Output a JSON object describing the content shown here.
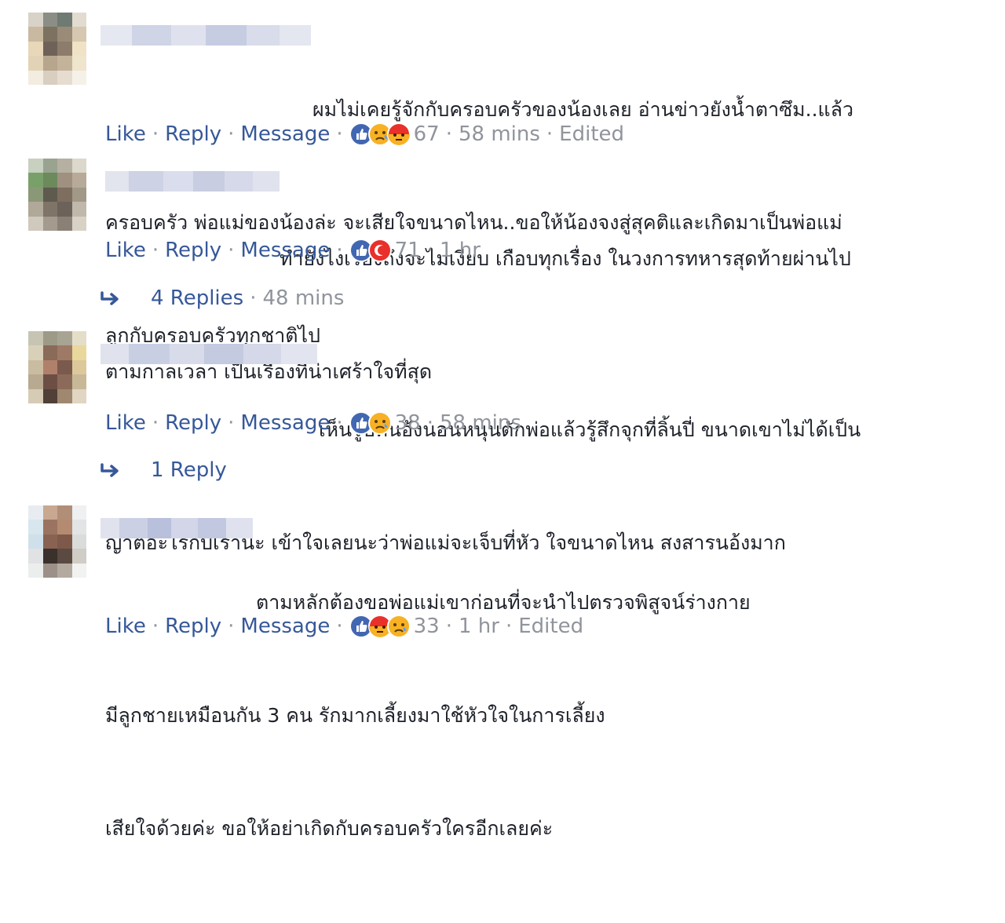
{
  "actions": {
    "like": "Like",
    "reply": "Reply",
    "message": "Message",
    "separator": "·"
  },
  "comments": [
    {
      "lines": [
        "ผมไม่เคยรู้จักกับครอบครัวของน้องเลย อ่านข่าวยังน้ำตาซึม..แล้ว",
        "ครอบครัว พ่อแม่ของน้องล่ะ จะเสียใจขนาดไหน..ขอให้น้องจงสู่สุคติและเกิดมาเป็นพ่อแม่",
        "ลูกกับครอบครัวทุกชาติไป"
      ],
      "reaction_icons": [
        "like-icon",
        "sad-icon",
        "angry-icon"
      ],
      "reaction_count": "67",
      "time": "58 mins",
      "edited": "Edited"
    },
    {
      "lines": [
        "ทำยังไงเรื่องถึงจะไม่เงียบ เกือบทุกเรื่อง ในวงการทหารสุดท้ายผ่านไป",
        "ตามกาลเวลา เป็นเรื่องที่น่าเศร้าใจที่สุด"
      ],
      "reaction_icons": [
        "like-icon",
        "angry-icon"
      ],
      "reaction_count": "71",
      "time": "1 hr",
      "replies": {
        "label": "4 Replies",
        "time": "48 mins"
      }
    },
    {
      "lines": [
        "เห็นรูปที่นอ้งนอนหนุนตักพ่อแล้วรู้สึกจุกที่ลิ้นปี่ ขนาดเขาไม่ได้เป็น",
        "ญาติอะไรกับเรานะ เข้าใจเลยนะว่าพ่อแม่จะเจ็บที่หัว ใจขนาดไหน สงสารนอ้งมาก"
      ],
      "reaction_icons": [
        "like-icon",
        "sad-icon"
      ],
      "reaction_count": "38",
      "time": "58 mins",
      "replies": {
        "label": "1 Reply"
      }
    },
    {
      "lines": [
        "ตามหลักต้องขอพ่อแม่เขาก่อนที่จะนำไปตรวจพิสูจน์ร่างกาย",
        "มีลูกชายเหมือนกัน 3 คน รักมากเลี้ยงมาใช้หัวใจในการเลี้ยง",
        "เสียใจด้วยค่ะ ขอให้อย่าเกิดกับครอบครัวใครอีกเลยค่ะ"
      ],
      "reaction_icons": [
        "like-icon",
        "angry-icon",
        "sad-icon"
      ],
      "reaction_count": "33",
      "time": "1 hr",
      "edited": "Edited"
    }
  ],
  "colors": {
    "link": "#365899",
    "muted": "#90949c",
    "text": "#1d2129",
    "like_blue": "#4267b2",
    "angry_red": "#e9302a",
    "sad_yellow": "#f7b125"
  }
}
